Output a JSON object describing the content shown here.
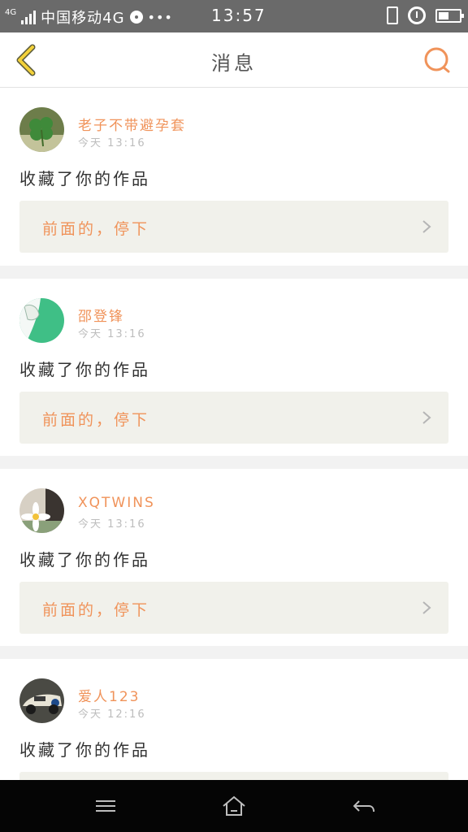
{
  "status_bar": {
    "network": "4G",
    "carrier": "中国移动4G",
    "time": "13:57",
    "more": "•••"
  },
  "header": {
    "title": "消息"
  },
  "messages": [
    {
      "username": "老子不带避孕套",
      "time": "今天 13:16",
      "action": "收藏了你的作品",
      "work_title": "前面的，停下"
    },
    {
      "username": "邵登锋",
      "time": "今天 13:16",
      "action": "收藏了你的作品",
      "work_title": "前面的，停下"
    },
    {
      "username": "XQTWINS",
      "time": "今天 13:16",
      "action": "收藏了你的作品",
      "work_title": "前面的，停下"
    },
    {
      "username": "爱人123",
      "time": "今天 12:16",
      "action": "收藏了你的作品",
      "work_title": ""
    }
  ],
  "colors": {
    "accent": "#f0935a",
    "status_bar": "#6a6a6a",
    "nav_bar": "#050505",
    "link_bg": "#f1f1eb",
    "back_arrow": "#f3d13a"
  },
  "icons": {
    "back": "chevron-left-icon",
    "search": "search-icon",
    "nav_menu": "menu-icon",
    "nav_home": "home-icon",
    "nav_back": "back-arrow-icon"
  }
}
